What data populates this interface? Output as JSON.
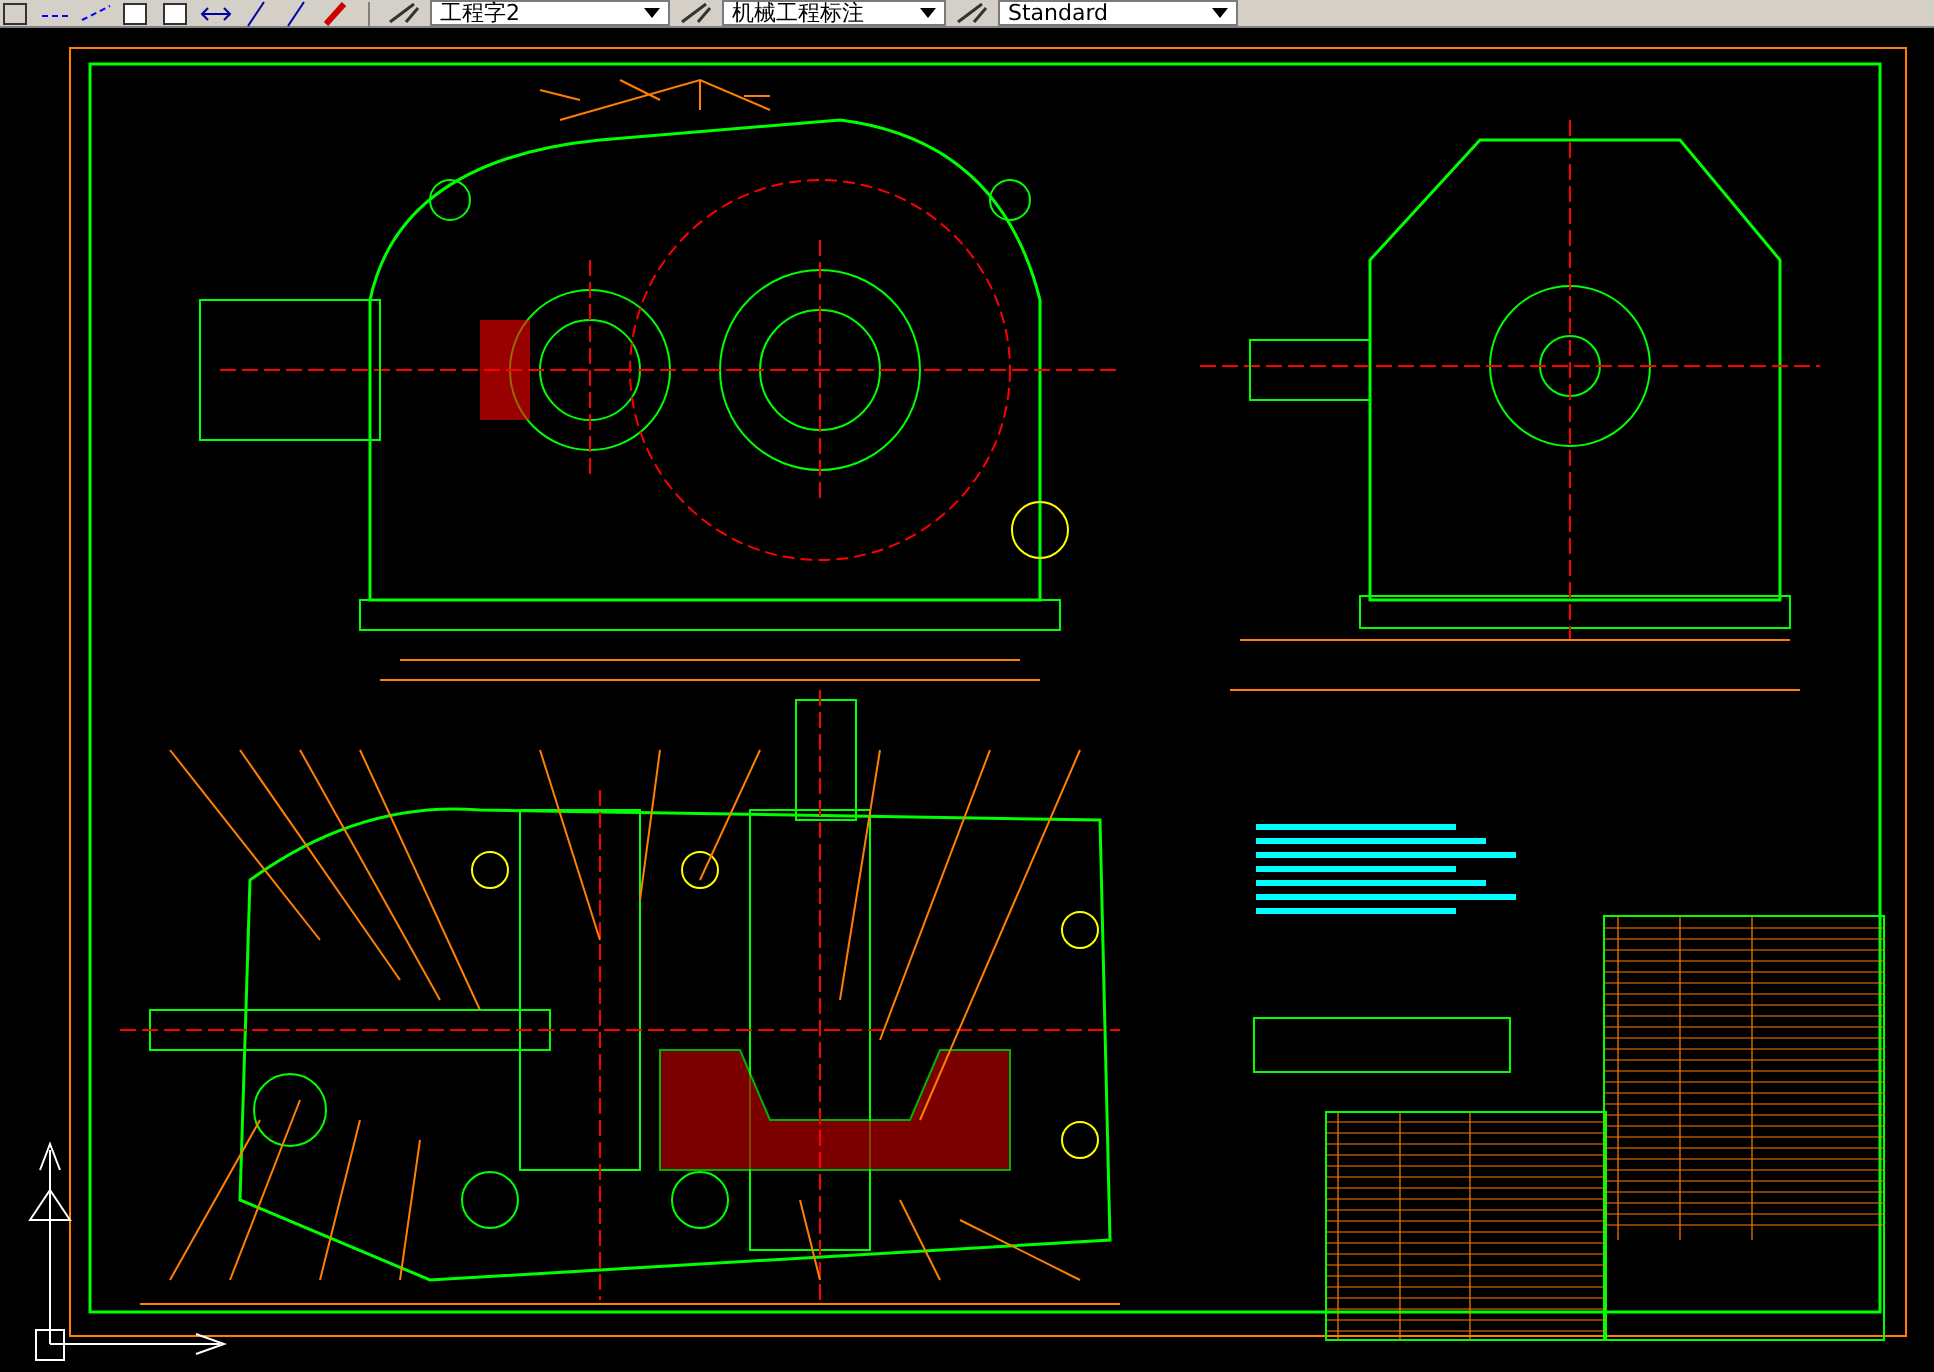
{
  "toolbar": {
    "dropdowns": [
      {
        "value": "工程字2"
      },
      {
        "value": "机械工程标注"
      },
      {
        "value": "Standard"
      }
    ]
  }
}
